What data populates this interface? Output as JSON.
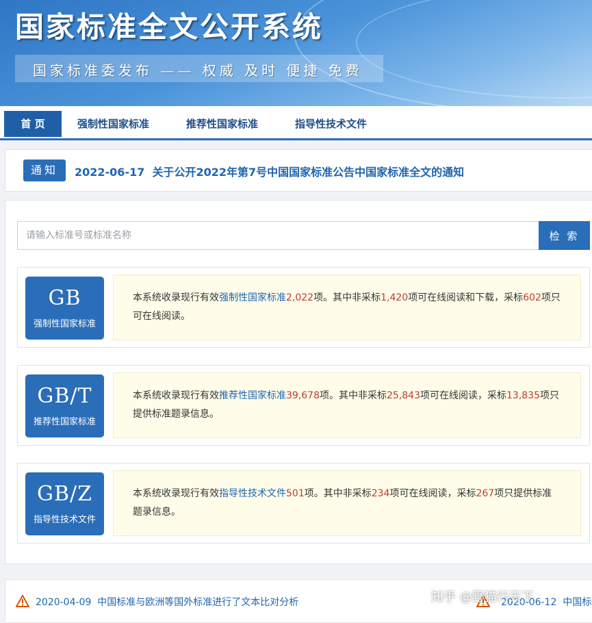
{
  "banner": {
    "title": "国家标准全文公开系统",
    "tagline": "国家标准委发布 —— 权威 及时 便捷 免费"
  },
  "nav": {
    "items": [
      {
        "label": "首 页",
        "active": true
      },
      {
        "label": "强制性国家标准",
        "active": false
      },
      {
        "label": "推荐性国家标准",
        "active": false
      },
      {
        "label": "指导性技术文件",
        "active": false
      }
    ]
  },
  "notice": {
    "badge": "通知",
    "date": "2022-06-17",
    "text": "关于公开2022年第7号中国国家标准公告中国家标准全文的通知"
  },
  "search": {
    "placeholder": "请输入标准号或标准名称",
    "value": "",
    "button_label": "检 索"
  },
  "cards": [
    {
      "code": "GB",
      "sub": "强制性国家标准",
      "p1": "本系统收录现行有效",
      "link": "强制性国家标准",
      "total": "2,022",
      "p2": "项。其中非采标",
      "n1": "1,420",
      "p3": "项可在线阅读和下载，采标",
      "n2": "602",
      "p4": "项只可在线阅读。"
    },
    {
      "code": "GB/T",
      "sub": "推荐性国家标准",
      "p1": "本系统收录现行有效",
      "link": "推荐性国家标准",
      "total": "39,678",
      "p2": "项。其中非采标",
      "n1": "25,843",
      "p3": "项可在线阅读，采标",
      "n2": "13,835",
      "p4": "项只提供标准题录信息。"
    },
    {
      "code": "GB/Z",
      "sub": "指导性技术文件",
      "p1": "本系统收录现行有效",
      "link": "指导性技术文件",
      "total": "501",
      "p2": "项。其中非采标",
      "n1": "234",
      "p3": "项可在线阅读，采标",
      "n2": "267",
      "p4": "项只提供标准题录信息。"
    }
  ],
  "news": [
    {
      "date": "2020-04-09",
      "text": "中国标准与欧洲等国外标准进行了文本比对分析"
    },
    {
      "date": "2020-06-12",
      "text": "中国标"
    }
  ],
  "watermark": "知乎 @野猫行天下",
  "colors": {
    "primary": "#2a6db8",
    "link": "#1f64b0",
    "number": "#c0392b",
    "desc_bg": "#fffde9"
  },
  "icons": {
    "news_marker": "warning-triangle-icon"
  }
}
